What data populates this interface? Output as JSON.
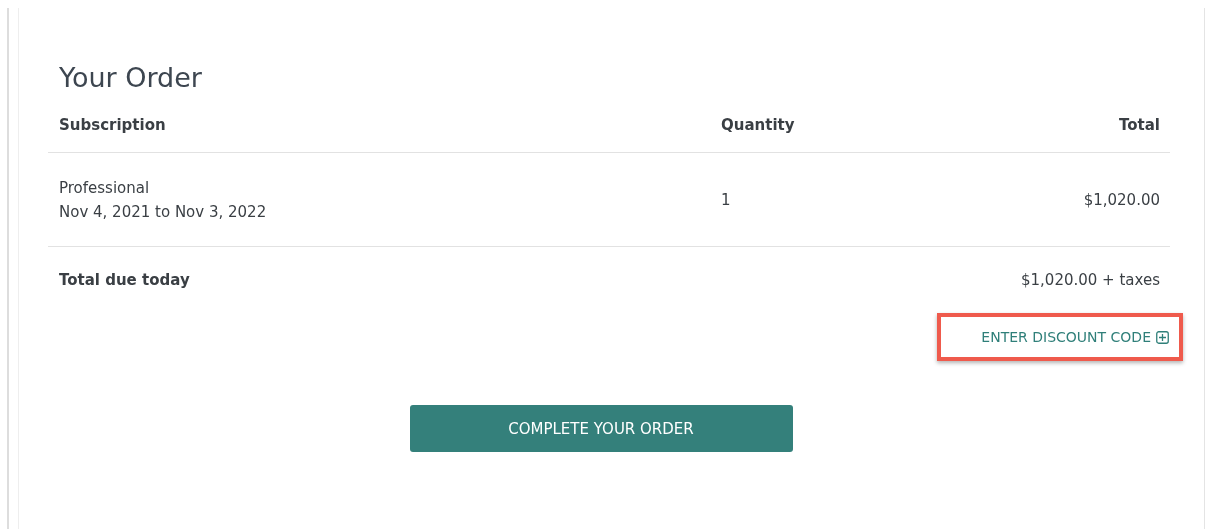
{
  "title": "Your Order",
  "columns": [
    "Subscription",
    "Quantity",
    "Total"
  ],
  "rows": [
    {
      "name": "Professional",
      "period": "Nov 4, 2021 to Nov 3, 2022",
      "quantity": "1",
      "total": "$1,020.00"
    }
  ],
  "summary": {
    "label": "Total due today",
    "value": "$1,020.00 + taxes"
  },
  "discount_link": {
    "label": "ENTER DISCOUNT CODE",
    "highlighted": true
  },
  "submit_button": "COMPLETE YOUR ORDER"
}
